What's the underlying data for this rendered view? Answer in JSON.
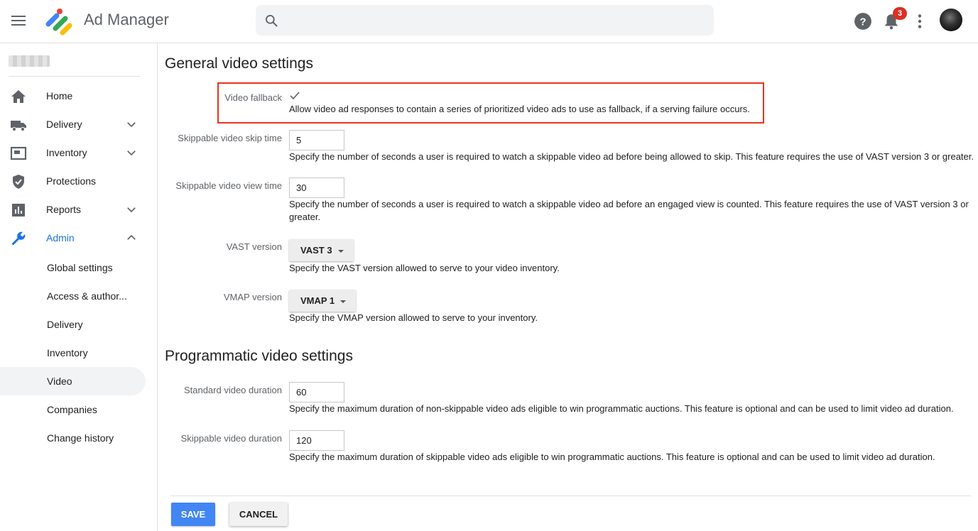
{
  "header": {
    "app_title": "Ad Manager",
    "search_placeholder": "",
    "notification_count": "3",
    "icons": [
      "menu-icon",
      "ad-manager-logo",
      "search-icon",
      "help-icon",
      "bell-icon",
      "more-vert-icon"
    ]
  },
  "sidebar": {
    "items": [
      {
        "label": "Home",
        "icon": "home-icon"
      },
      {
        "label": "Delivery",
        "icon": "truck-icon",
        "expandable": true
      },
      {
        "label": "Inventory",
        "icon": "inventory-icon",
        "expandable": true
      },
      {
        "label": "Protections",
        "icon": "shield-icon"
      },
      {
        "label": "Reports",
        "icon": "bar-chart-icon",
        "expandable": true
      },
      {
        "label": "Admin",
        "icon": "wrench-icon",
        "expanded": true,
        "active": true
      }
    ],
    "admin_subitems": [
      {
        "label": "Global settings"
      },
      {
        "label": "Access & author..."
      },
      {
        "label": "Delivery"
      },
      {
        "label": "Inventory"
      },
      {
        "label": "Video",
        "selected": true
      },
      {
        "label": "Companies"
      },
      {
        "label": "Change history"
      }
    ]
  },
  "general": {
    "title": "General video settings",
    "video_fallback": {
      "label": "Video fallback",
      "checked": true,
      "help": "Allow video ad responses to contain a series of prioritized video ads to use as fallback, if a serving failure occurs."
    },
    "skip_time": {
      "label": "Skippable video skip time",
      "value": "5",
      "help": "Specify the number of seconds a user is required to watch a skippable video ad before being allowed to skip. This feature requires the use of VAST version 3 or greater."
    },
    "view_time": {
      "label": "Skippable video view time",
      "value": "30",
      "help_line1": "Specify the number of seconds a user is required to watch a skippable video ad before an engaged view is counted. This feature requires the use of VAST version 3 or",
      "help_line2": "greater."
    },
    "vast": {
      "label": "VAST version",
      "value": "VAST 3",
      "help": "Specify the VAST version allowed to serve to your video inventory."
    },
    "vmap": {
      "label": "VMAP version",
      "value": "VMAP 1",
      "help": "Specify the VMAP version allowed to serve to your inventory."
    }
  },
  "programmatic": {
    "title": "Programmatic video settings",
    "standard_duration": {
      "label": "Standard video duration",
      "value": "60",
      "help": "Specify the maximum duration of non-skippable video ads eligible to win programmatic auctions. This feature is optional and can be used to limit video ad duration."
    },
    "skippable_duration": {
      "label": "Skippable video duration",
      "value": "120",
      "help": "Specify the maximum duration of skippable video ads eligible to win programmatic auctions. This feature is optional and can be used to limit video ad duration."
    }
  },
  "actions": {
    "save_label": "SAVE",
    "cancel_label": "CANCEL"
  },
  "colors": {
    "accent": "#1a73e8",
    "save_button": "#4285f4",
    "highlight_box": "#e8341c",
    "badge": "#d93025"
  }
}
